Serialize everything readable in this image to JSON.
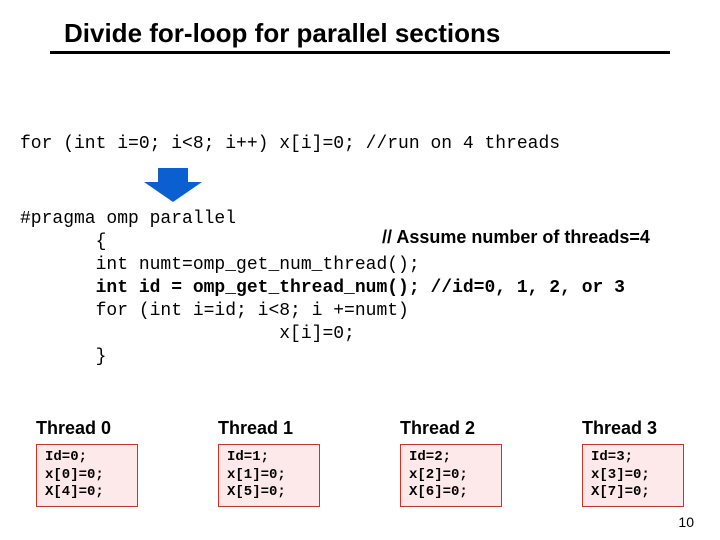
{
  "title": "Divide for-loop for parallel sections",
  "code_line": "for (int i=0; i<8; i++) x[i]=0; //run on 4 threads",
  "assume": "// Assume number of threads=4",
  "block": {
    "l0": "#pragma omp parallel",
    "l1": "       {",
    "l2": "       int numt=omp_get_num_thread();",
    "l3": "       int id = omp_get_thread_num(); //id=0, 1, 2, or 3",
    "l4": "       for (int i=id; i<8; i +=numt)",
    "l5": "                        x[i]=0;",
    "l6": "",
    "l7": "       }"
  },
  "threads": [
    {
      "label": "Thread 0",
      "l1": "Id=0;",
      "l2": "x[0]=0;",
      "l3": "X[4]=0;"
    },
    {
      "label": "Thread 1",
      "l1": "Id=1;",
      "l2": "x[1]=0;",
      "l3": "X[5]=0;"
    },
    {
      "label": "Thread 2",
      "l1": "Id=2;",
      "l2": "x[2]=0;",
      "l3": "X[6]=0;"
    },
    {
      "label": "Thread 3",
      "l1": "Id=3;",
      "l2": "x[3]=0;",
      "l3": "X[7]=0;"
    }
  ],
  "page": "10"
}
